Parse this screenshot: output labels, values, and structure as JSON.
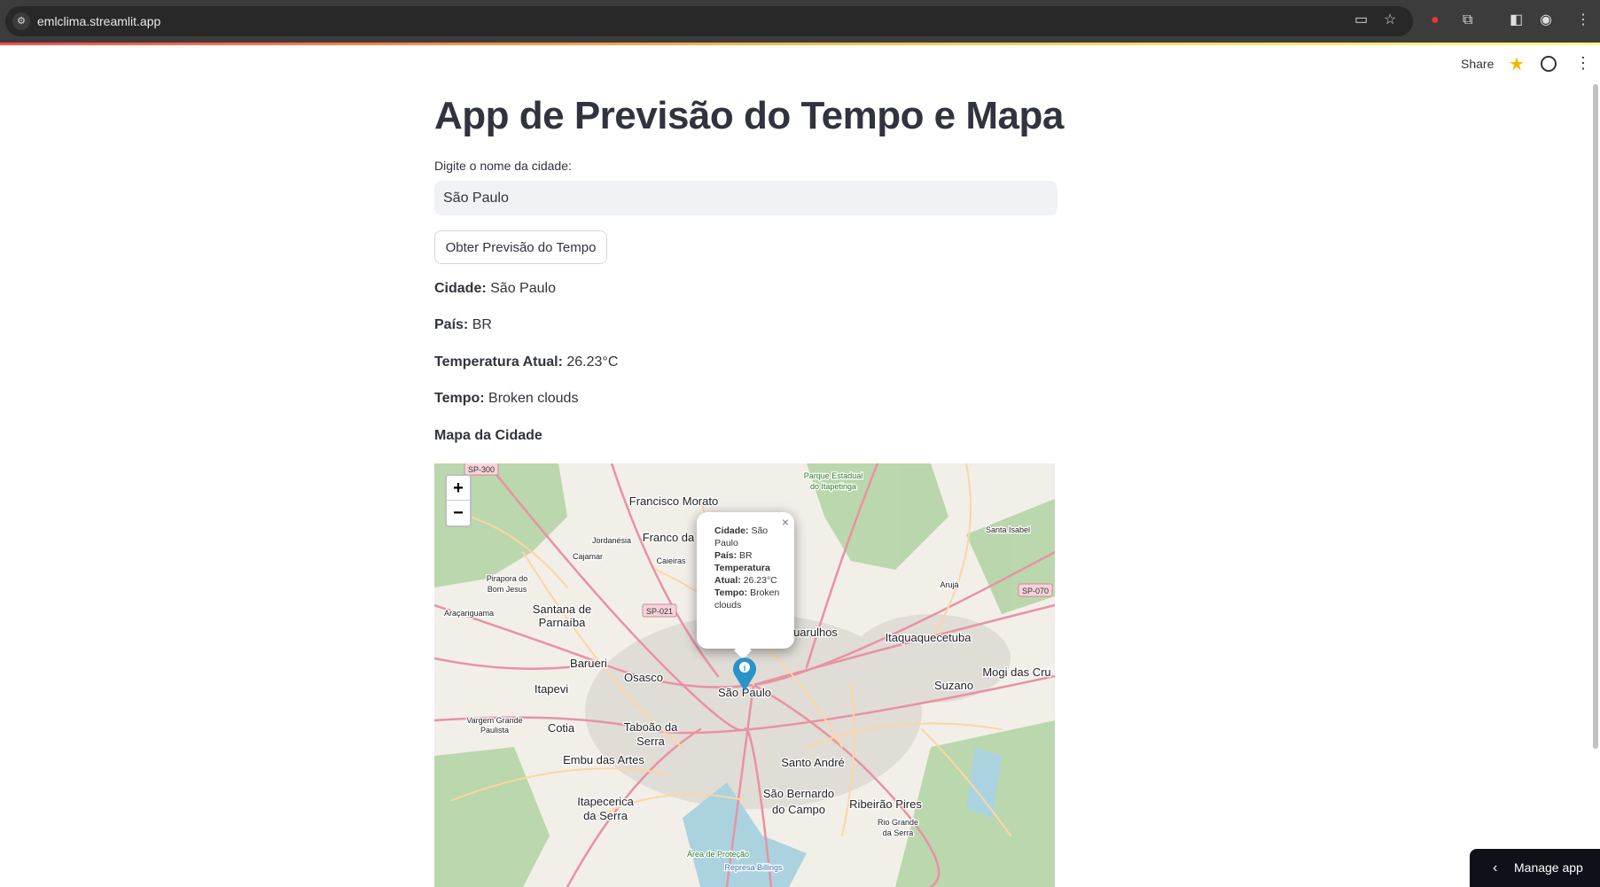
{
  "browser": {
    "url": "emlclima.streamlit.app"
  },
  "header": {
    "share": "Share"
  },
  "page": {
    "title": "App de Previsão do Tempo e Mapa",
    "input_label": "Digite o nome da cidade:",
    "input_value": "São Paulo",
    "button": "Obter Previsão do Tempo",
    "results": [
      {
        "key": "Cidade:",
        "value": "São Paulo"
      },
      {
        "key": "País:",
        "value": "BR"
      },
      {
        "key": "Temperatura Atual:",
        "value": "26.23°C"
      },
      {
        "key": "Tempo:",
        "value": "Broken clouds"
      }
    ],
    "map_heading": "Mapa da Cidade"
  },
  "map": {
    "zoom_in": "+",
    "zoom_out": "−",
    "popup": {
      "city_key": "Cidade:",
      "city": "São Paulo",
      "country_key": "País:",
      "country": "BR",
      "temp_key": "Temperatura Atual:",
      "temp": "26.23°C",
      "weather_key": "Tempo:",
      "weather": "Broken clouds",
      "close": "×"
    },
    "labels": [
      "Francisco Morato",
      "Franco da",
      "Jordanésia",
      "Cajamar",
      "Caieiras",
      "Pirapora do",
      "Bom Jesus",
      "Santana de",
      "Parnaíba",
      "Araçariguama",
      "Barueri",
      "Osasco",
      "Itapevi",
      "São Paulo",
      "Vargem Grande",
      "Paulista",
      "Cotia",
      "Taboão da",
      "Serra",
      "Embu das Artes",
      "Santo André",
      "São Bernardo",
      "do Campo",
      "Itapecerica",
      "da Serra",
      "Ribeirão Pires",
      "Rio Grande",
      "da Serra",
      "uarulhos",
      "Itaquaquecetuba",
      "Mogi das Cru",
      "Suzano",
      "Arujá",
      "Santa Isabel",
      "Parque Estadual",
      "do Itapetinga",
      "Área de Proteção",
      "Represa Billings"
    ],
    "shields": [
      "SP-300",
      "SP-021",
      "SP-070"
    ],
    "colors": {
      "background": "#f2efe9",
      "forest": "#add19e",
      "road_major": "#e892a2",
      "road_minor": "#fcd6a4",
      "marker": "#2a93c9"
    }
  },
  "manage_app": "Manage app"
}
